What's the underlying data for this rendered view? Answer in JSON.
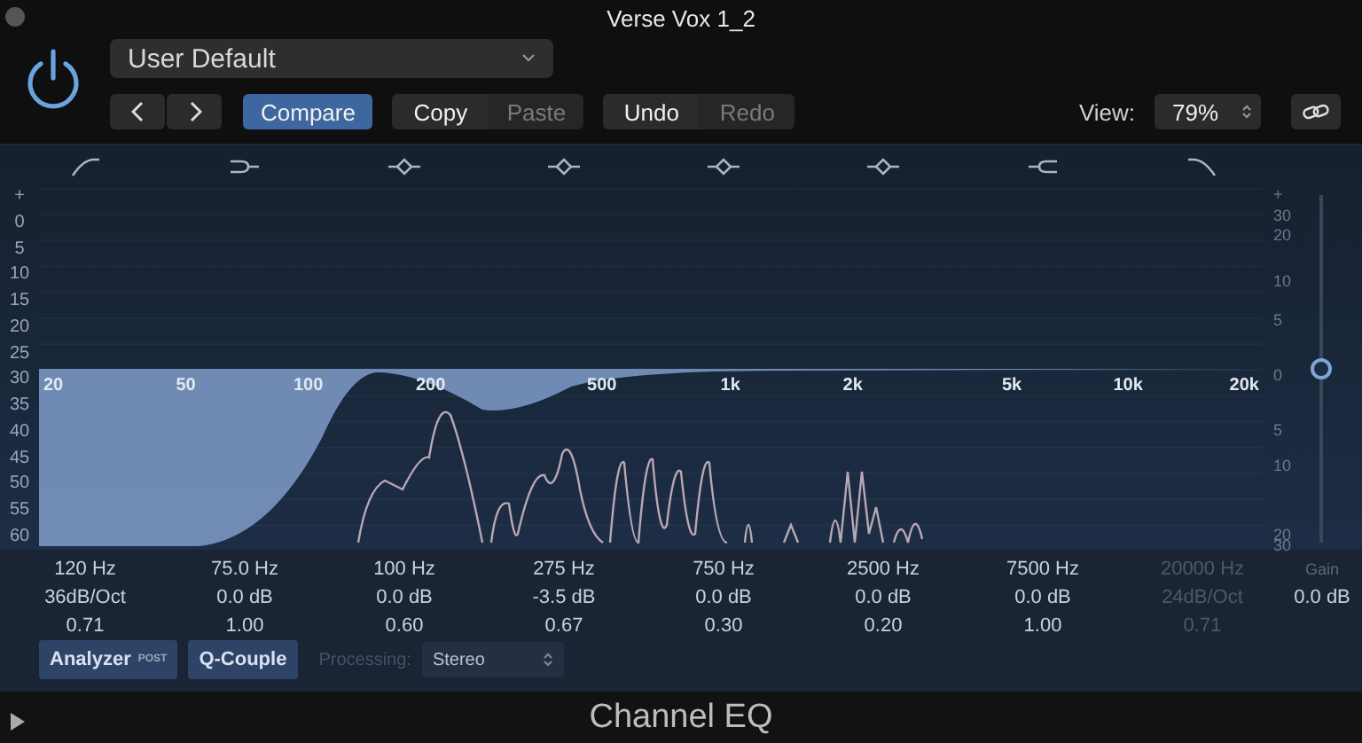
{
  "window": {
    "title": "Verse Vox 1_2"
  },
  "header": {
    "power_on": true,
    "preset": "User Default",
    "view_label": "View:",
    "view_value": "79%",
    "buttons": [
      {
        "label": "Compare",
        "kind": "toggle",
        "selected": true,
        "disabled": false
      },
      {
        "label": "Copy",
        "kind": "group-start",
        "selected": false,
        "disabled": false
      },
      {
        "label": "Paste",
        "kind": "group-end",
        "selected": false,
        "disabled": true
      },
      {
        "label": "Undo",
        "kind": "group-start",
        "selected": false,
        "disabled": false
      },
      {
        "label": "Redo",
        "kind": "group-end",
        "selected": false,
        "disabled": true
      }
    ]
  },
  "graph": {
    "db_scale": [
      "+",
      "0",
      "5",
      "10",
      "15",
      "20",
      "25",
      "30",
      "35",
      "40",
      "45",
      "50",
      "55",
      "60"
    ],
    "frequency_labels": [
      "20",
      "50",
      "100",
      "200",
      "500",
      "1k",
      "2k",
      "5k",
      "10k",
      "20k"
    ],
    "gain_scale": [
      "+",
      "30",
      "20",
      "10",
      "5",
      "0",
      "5",
      "10",
      "20",
      "30"
    ],
    "gain_slider": {
      "level": 0.5
    }
  },
  "bands": [
    {
      "kind": "low-cut",
      "frequency": "120 Hz",
      "setting": "36dB/Oct",
      "q": "0.71",
      "enabled": true
    },
    {
      "kind": "low-shelf",
      "frequency": "75.0 Hz",
      "setting": "0.0 dB",
      "q": "1.00",
      "enabled": true
    },
    {
      "kind": "bell",
      "frequency": "100 Hz",
      "setting": "0.0 dB",
      "q": "0.60",
      "enabled": true
    },
    {
      "kind": "bell",
      "frequency": "275 Hz",
      "setting": "-3.5 dB",
      "q": "0.67",
      "enabled": true
    },
    {
      "kind": "bell",
      "frequency": "750 Hz",
      "setting": "0.0 dB",
      "q": "0.30",
      "enabled": true
    },
    {
      "kind": "bell",
      "frequency": "2500 Hz",
      "setting": "0.0 dB",
      "q": "0.20",
      "enabled": true
    },
    {
      "kind": "high-shelf",
      "frequency": "7500 Hz",
      "setting": "0.0 dB",
      "q": "1.00",
      "enabled": true
    },
    {
      "kind": "high-cut",
      "frequency": "20000 Hz",
      "setting": "24dB/Oct",
      "q": "0.71",
      "enabled": false
    }
  ],
  "gain": {
    "label": "Gain",
    "value": "0.0 dB"
  },
  "controls": {
    "analyzer": {
      "label": "Analyzer",
      "badge": "POST",
      "on": true
    },
    "q_couple": {
      "label": "Q-Couple",
      "on": true
    },
    "processing_label": "Processing:",
    "processing_value": "Stereo"
  },
  "footer": {
    "title": "Channel EQ"
  }
}
